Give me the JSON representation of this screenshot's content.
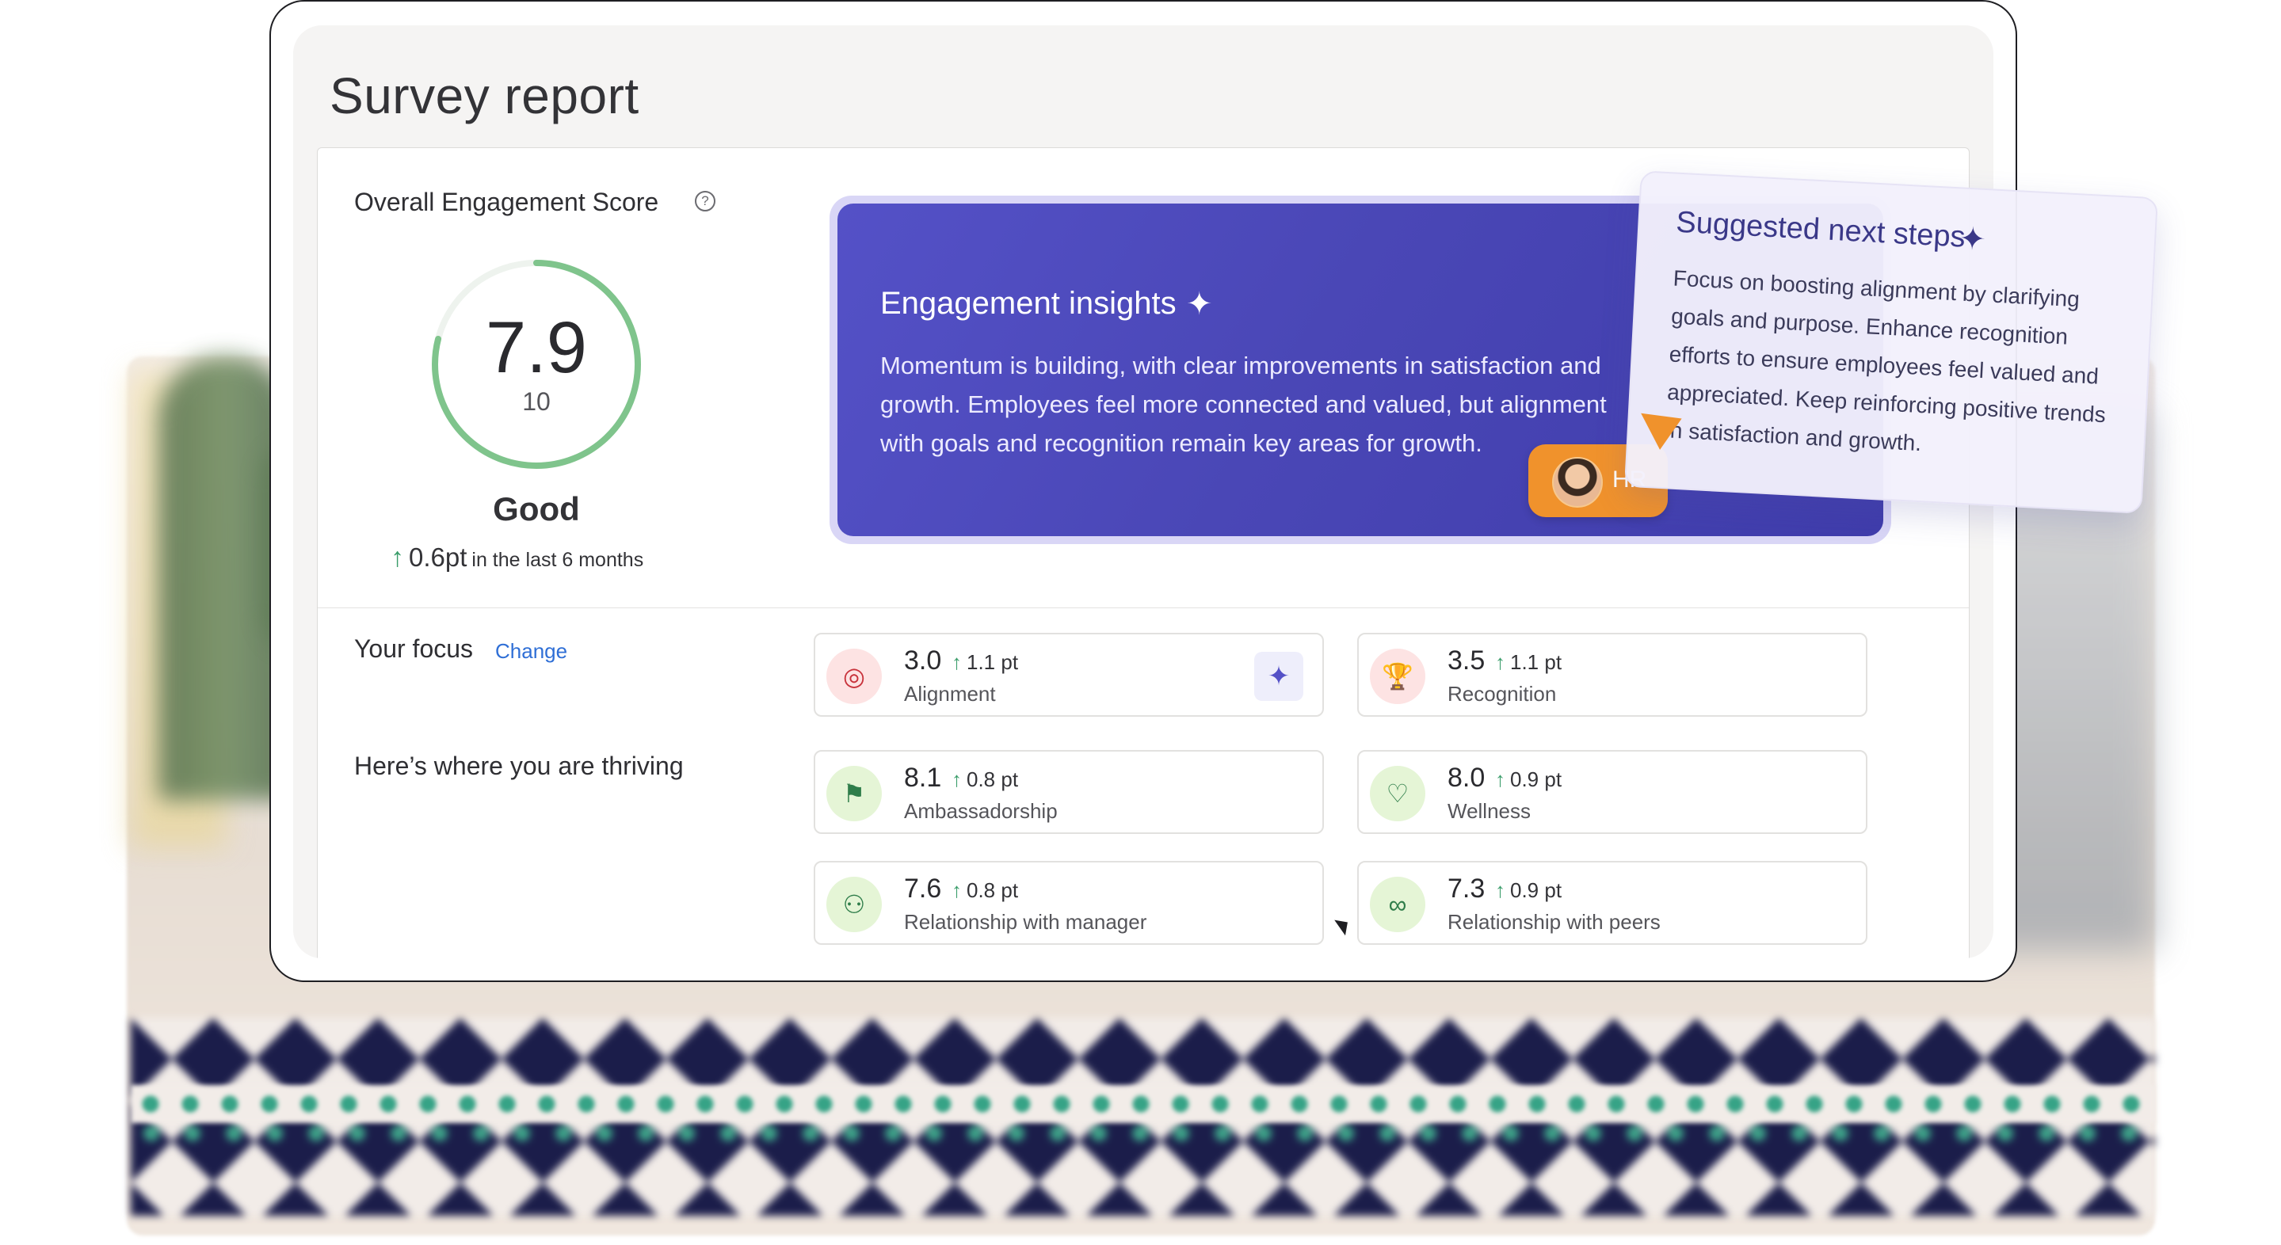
{
  "page": {
    "title": "Survey report"
  },
  "score": {
    "label": "Overall Engagement Score",
    "help_icon": "?",
    "value": "7.9",
    "max": "10",
    "fraction": 0.79,
    "rating": "Good",
    "trend_arrow": "↑",
    "trend_value": "0.6pt",
    "trend_period": "in the last 6 months",
    "gauge_color": "#7fc48c"
  },
  "insights": {
    "title": "Engagement insights",
    "spark_icon": "✦",
    "body": "Momentum is building, with clear improvements in satisfaction and growth. Employees feel more connected and valued, but alignment with goals and recognition remain key areas for growth.",
    "badge_label": "HR",
    "colors": {
      "from": "#5451c7",
      "to": "#3f3cab",
      "badge": "#f0922c"
    }
  },
  "focus": {
    "label": "Your focus",
    "change_label": "Change",
    "items": [
      {
        "value": "3.0",
        "arrow": "↑",
        "delta": "1.1 pt",
        "name": "Alignment",
        "icon": "target-icon",
        "icon_glyph": "◎",
        "ai_glyph": "✦"
      },
      {
        "value": "3.5",
        "arrow": "↑",
        "delta": "1.1 pt",
        "name": "Recognition",
        "icon": "trophy-icon",
        "icon_glyph": "🏆"
      }
    ]
  },
  "thriving": {
    "label": "Here’s where you are thriving",
    "items": [
      {
        "value": "8.1",
        "arrow": "↑",
        "delta": "0.8 pt",
        "name": "Ambassadorship",
        "icon": "flag-icon",
        "icon_glyph": "⚑"
      },
      {
        "value": "8.0",
        "arrow": "↑",
        "delta": "0.9 pt",
        "name": "Wellness",
        "icon": "heart-plus-icon",
        "icon_glyph": "♡"
      },
      {
        "value": "7.6",
        "arrow": "↑",
        "delta": "0.8 pt",
        "name": "Relationship with manager",
        "icon": "hierarchy-icon",
        "icon_glyph": "⚇"
      },
      {
        "value": "7.3",
        "arrow": "↑",
        "delta": "0.9 pt",
        "name": "Relationship with peers",
        "icon": "link-icon",
        "icon_glyph": "∞"
      }
    ]
  },
  "suggested": {
    "title": "Suggested next steps",
    "spark_icon": "✦",
    "body": "Focus on boosting alignment by clarifying goals and purpose. Enhance recognition efforts to ensure employees feel valued and appreciated. Keep reinforcing positive trends in satisfaction and growth."
  }
}
